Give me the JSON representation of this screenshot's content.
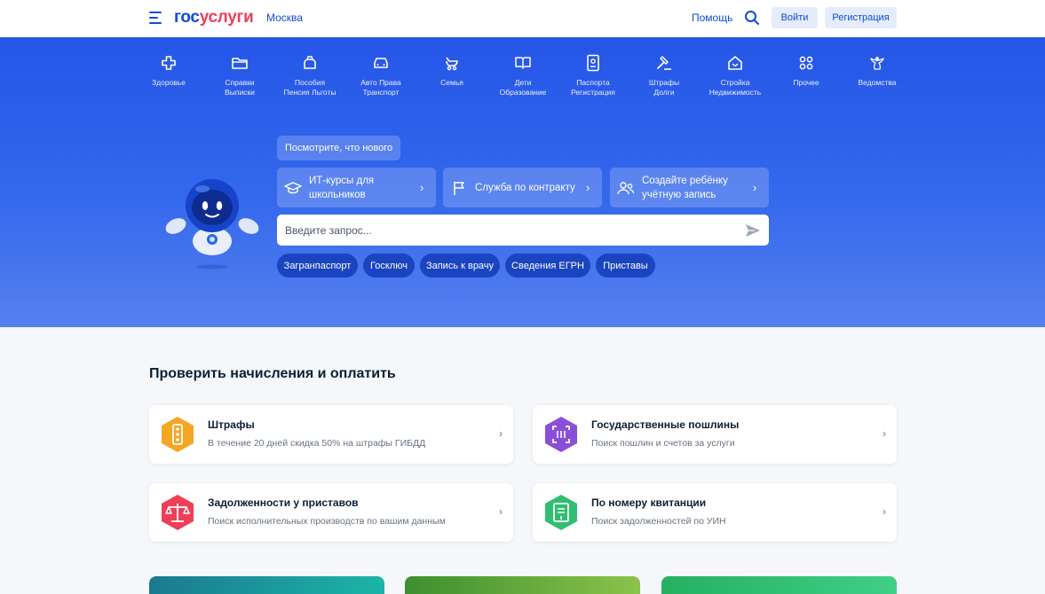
{
  "header": {
    "logo_part1": "гос",
    "logo_part2": "услуги",
    "city": "Москва",
    "help": "Помощь",
    "login": "Войти",
    "register": "Регистрация"
  },
  "categories": [
    {
      "line1": "Здоровье",
      "line2": "",
      "icon": "cross-icon"
    },
    {
      "line1": "Справки",
      "line2": "Выписки",
      "icon": "folder-icon"
    },
    {
      "line1": "Пособия",
      "line2": "Пенсия Льготы",
      "icon": "bag-icon"
    },
    {
      "line1": "Авто Права",
      "line2": "Транспорт",
      "icon": "car-icon"
    },
    {
      "line1": "Семья",
      "line2": "",
      "icon": "stroller-icon"
    },
    {
      "line1": "Дети",
      "line2": "Образование",
      "icon": "book-icon"
    },
    {
      "line1": "Паспорта",
      "line2": "Регистрация",
      "icon": "passport-icon"
    },
    {
      "line1": "Штрафы",
      "line2": "Долги",
      "icon": "gavel-icon"
    },
    {
      "line1": "Стройка",
      "line2": "Недвижимость",
      "icon": "house-icon"
    },
    {
      "line1": "Прочее",
      "line2": "",
      "icon": "grid-icon"
    },
    {
      "line1": "Ведомства",
      "line2": "",
      "icon": "emblem-icon"
    }
  ],
  "hero": {
    "whats_new": "Посмотрите, что нового",
    "promos": [
      {
        "line1": "ИТ-курсы для",
        "line2": "школьников",
        "icon": "graduation-cap-icon"
      },
      {
        "line1": "Служба по контракту",
        "line2": "",
        "icon": "flag-icon"
      },
      {
        "line1": "Создайте ребёнку",
        "line2": "учётную запись",
        "icon": "users-icon"
      }
    ],
    "search_placeholder": "Введите запрос...",
    "chips": [
      "Загранпаспорт",
      "Госключ",
      "Запись к врачу",
      "Сведения ЕГРН",
      "Приставы"
    ]
  },
  "section": {
    "title": "Проверить начисления и оплатить",
    "cards": [
      {
        "title": "Штрафы",
        "subtitle": "В течение 20 дней скидка 50% на штрафы ГИБДД",
        "color": "#f5a623",
        "icon": "traffic-light-icon"
      },
      {
        "title": "Государственные пошлины",
        "subtitle": "Поиск пошлин и счетов за услуги",
        "color": "#8a4fd8",
        "icon": "scan-icon"
      },
      {
        "title": "Задолженности у приставов",
        "subtitle": "Поиск исполнительных производств по вашим данным",
        "color": "#ee3f58",
        "icon": "scales-icon"
      },
      {
        "title": "По номеру квитанции",
        "subtitle": "Поиск задолженностей по УИН",
        "color": "#2fbf71",
        "icon": "receipt-icon"
      }
    ]
  },
  "colors": {
    "brand_blue": "#0d4cd3",
    "brand_red": "#ee3f58",
    "hero_blue": "#2556e8"
  }
}
